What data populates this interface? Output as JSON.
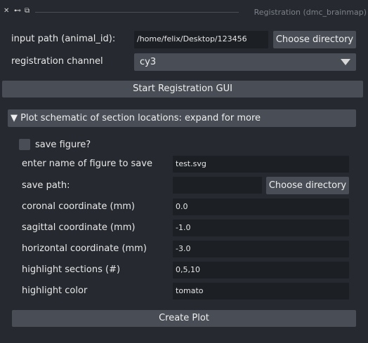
{
  "window": {
    "title": "Registration (dmc_brainmap)",
    "close_glyph": "✕",
    "pin_glyph": "⊷",
    "popout_glyph": "⧉"
  },
  "registration": {
    "input_path_label": "input path (animal_id):",
    "input_path_value": "/home/felix/Desktop/123456",
    "choose_directory_label": "Choose directory",
    "channel_label": "registration channel",
    "channel_selected": "cy3",
    "start_button_label": "Start Registration GUI"
  },
  "plot_section": {
    "header_label": "▼ Plot schematic of section locations: expand for more",
    "save_figure_label": "save figure?",
    "figure_name_label": "enter name of figure to save",
    "figure_name_value": "test.svg",
    "save_path_label": "save path:",
    "save_path_value": "",
    "choose_directory_label": "Choose directory",
    "coronal_label": "coronal coordinate (mm)",
    "coronal_value": "0.0",
    "sagittal_label": "sagittal coordinate (mm)",
    "sagittal_value": "-1.0",
    "horizontal_label": "horizontal coordinate (mm)",
    "horizontal_value": "-3.0",
    "highlight_sections_label": "highlight sections (#)",
    "highlight_sections_value": "0,5,10",
    "highlight_color_label": "highlight color",
    "highlight_color_value": "tomato",
    "create_plot_label": "Create Plot"
  },
  "icons": [
    "close-icon",
    "pin-icon",
    "popout-icon",
    "chevron-down-icon",
    "triangle-down-icon"
  ],
  "colors": {
    "background": "#262a30",
    "input_background": "#1c1f24",
    "button_background": "#494e56",
    "text": "#e8e8e8",
    "muted_text": "#7c8088"
  }
}
